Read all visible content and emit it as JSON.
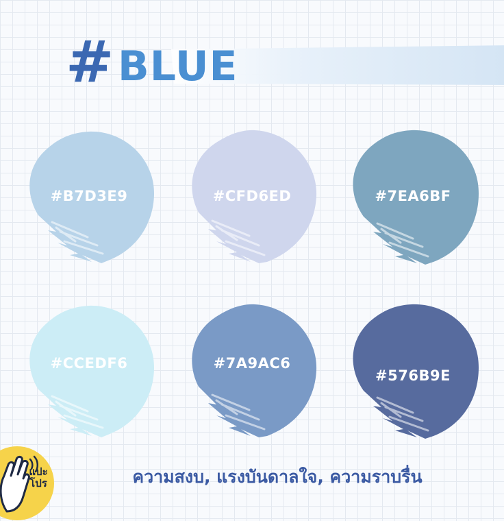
{
  "header": {
    "hash": "#",
    "title": "BLUE"
  },
  "swatches": [
    {
      "label": "#B7D3E9",
      "color": "#B7D3E9"
    },
    {
      "label": "#CFD6ED",
      "color": "#CFD6ED"
    },
    {
      "label": "#7EA6BF",
      "color": "#7EA6BF"
    },
    {
      "label": "#CCEDF6",
      "color": "#CCEDF6"
    },
    {
      "label": "#7A9AC6",
      "color": "#7A9AC6"
    },
    {
      "label": "#576B9E",
      "color": "#576B9E"
    }
  ],
  "subtitle": "ความสงบ, แรงบันดาลใจ, ความราบรื่น",
  "logo": {
    "icon": "waving-hand-icon",
    "text_line1": "แปะ",
    "text_line2": "โปร",
    "badge_color": "#F6D34A"
  },
  "colors": {
    "hash": "#3B68B2",
    "title": "#4A8FD2",
    "subtitle": "#3B5AA3",
    "brush": "#D9E8F6"
  }
}
